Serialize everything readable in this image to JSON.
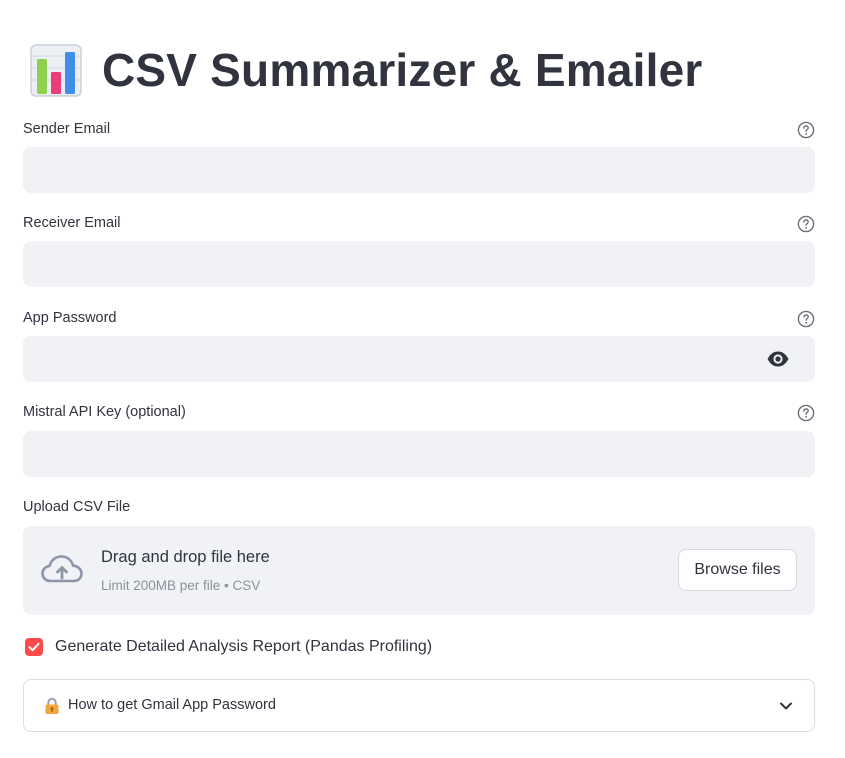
{
  "page": {
    "title": "CSV Summarizer & Emailer",
    "title_icon": "bar-chart-emoji-icon"
  },
  "fields": {
    "sender_email": {
      "label": "Sender Email",
      "value": "",
      "help_icon": "question-circle-icon"
    },
    "receiver_email": {
      "label": "Receiver Email",
      "value": "",
      "help_icon": "question-circle-icon"
    },
    "app_password": {
      "label": "App Password",
      "value": "",
      "help_icon": "question-circle-icon",
      "toggle_icon": "eye-icon"
    },
    "mistral_api_key": {
      "label": "Mistral API Key (optional)",
      "value": "",
      "help_icon": "question-circle-icon"
    }
  },
  "upload": {
    "label": "Upload CSV File",
    "drop_text": "Drag and drop file here",
    "limit_text": "Limit 200MB per file • CSV",
    "browse_label": "Browse files",
    "icon": "cloud-upload-icon"
  },
  "checkbox": {
    "label": "Generate Detailed Analysis Report (Pandas Profiling)",
    "checked": true
  },
  "expander": {
    "label": "How to get Gmail App Password",
    "icon": "lock-key-icon",
    "expanded": false
  },
  "colors": {
    "accent": "#ff4b4b",
    "input_bg": "#f0f2f6",
    "text": "#31333f",
    "muted": "#8e919b"
  }
}
